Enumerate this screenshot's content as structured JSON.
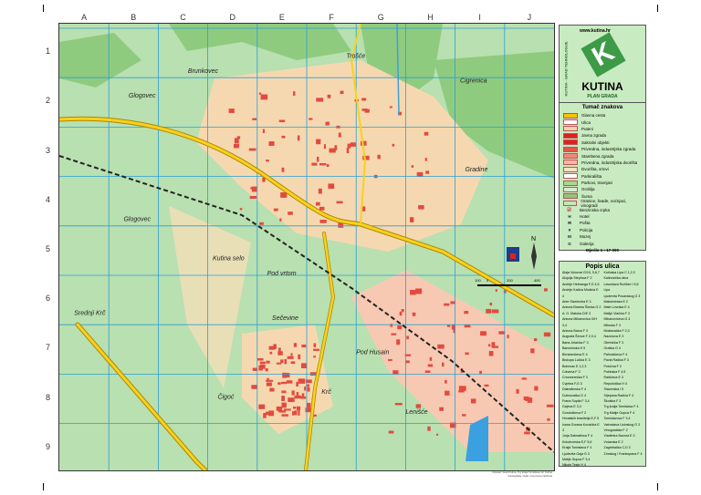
{
  "columns": [
    "A",
    "B",
    "C",
    "D",
    "E",
    "F",
    "G",
    "H",
    "I",
    "J"
  ],
  "rows": [
    "1",
    "2",
    "3",
    "4",
    "5",
    "6",
    "7",
    "8",
    "9"
  ],
  "places": [
    {
      "name": "Brunkovec",
      "c": 2.6,
      "r": 0.9
    },
    {
      "name": "Trošće",
      "c": 5.8,
      "r": 0.6
    },
    {
      "name": "Cigrenica",
      "c": 8.1,
      "r": 1.1
    },
    {
      "name": "Glogovec",
      "c": 1.4,
      "r": 1.4
    },
    {
      "name": "Gradine",
      "c": 8.2,
      "r": 2.9
    },
    {
      "name": "Glogovec",
      "c": 1.3,
      "r": 3.9
    },
    {
      "name": "Kutina selo",
      "c": 3.1,
      "r": 4.7
    },
    {
      "name": "Pod vrtom",
      "c": 4.2,
      "r": 5.0
    },
    {
      "name": "Srednji Krč",
      "c": 0.3,
      "r": 5.8
    },
    {
      "name": "Sečevine",
      "c": 4.3,
      "r": 5.9
    },
    {
      "name": "Pod Husain",
      "c": 6.0,
      "r": 6.6
    },
    {
      "name": "Krč",
      "c": 5.3,
      "r": 7.4
    },
    {
      "name": "Čigoć",
      "c": 3.2,
      "r": 7.5
    },
    {
      "name": "Lenišće",
      "c": 7.0,
      "r": 7.8
    }
  ],
  "logo": {
    "url": "www.kutina.hr",
    "side_text": "KUTINA - GRAD TEHNOLOGIJE",
    "title": "KUTINA",
    "subtitle": "PLAN GRADA"
  },
  "legend": {
    "title": "Tumač znakova",
    "items": [
      {
        "label": "Glavna cesta",
        "color": "#f2c400"
      },
      {
        "label": "Ulica",
        "color": "#ffffff"
      },
      {
        "label": "Puteni",
        "color": "#e9d6b0"
      },
      {
        "label": "Javna zgrada",
        "color": "#e02020"
      },
      {
        "label": "Sakralni objekti",
        "color": "#e02020"
      },
      {
        "label": "Privredna, industrijska zgrada",
        "color": "#e8554a"
      },
      {
        "label": "Stambena zgrada",
        "color": "#f08a78"
      },
      {
        "label": "Privredna, industrijska dvorišta",
        "color": "#f6b7a2"
      },
      {
        "label": "Dvorišta, vrtovi",
        "color": "#fbe0c0"
      },
      {
        "label": "Parkirališta",
        "color": "#ffffff"
      },
      {
        "label": "Parkovi, travnjaci",
        "color": "#a8d88e"
      },
      {
        "label": "Groblja",
        "color": "#d9ead0"
      },
      {
        "label": "Šuma",
        "color": "#8cc77a"
      },
      {
        "label": "Oranice, livade, voćnjaci, vinogradi",
        "color": "#c4e6b8"
      },
      {
        "label": "Benzinska crpka",
        "icon": "⛽"
      },
      {
        "label": "Hotel",
        "icon": "H"
      },
      {
        "label": "Pošta",
        "icon": "✉"
      },
      {
        "label": "Policija",
        "icon": "▼"
      },
      {
        "label": "Muzej",
        "icon": "M"
      },
      {
        "label": "Galerija",
        "icon": "G"
      }
    ],
    "scale": "Mjerilo 1 : 17 000"
  },
  "scalebar": {
    "ticks": [
      "100",
      "0",
      "200",
      "400"
    ],
    "north": "N"
  },
  "index": {
    "title": "Popis ulica",
    "col1": [
      "Alaja Vukovar  G/10, 5,6,7",
      "Alojzija Stepinca  F 2",
      "Andrije Hebranga  F,G 4,5",
      "Andrije Kačića Miošića  E 4",
      "Ante Starčevića  E 3",
      "Antuna Branka Šimića  G 2",
      "A. G. Matoša  D/E 3",
      "Antuna Mihanovića  G/H 3,4",
      "Antuna Barca  F 3",
      "Augusta Šenoe  F 2,3,4",
      "Bana Jelačića  F 3",
      "Banovinska  H 5",
      "Berislavićeva  E 4",
      "Biskupa Lučića  E 3",
      "Bobovac  E 1,2,3",
      "Crkvena  F 3",
      "Crnomerečka  F 3",
      "Cvjetna  F,G 3",
      "Dalmatinska  F 4",
      "Dubrovačka  G 4",
      "Frana Supila  F 3,4",
      "Gajeva  E 3,4",
      "Gundulićeva  F 2",
      "Hrvatskih branitelja  E,F 5",
      "Ivana Gorana Kovačića  E 3",
      "Jurja Dalmatinca  F 4",
      "Kolodvorska  E,F 5,6",
      "Kralja Tomislava  F 4",
      "Ljudevita Gaja  G 3",
      "Matije Gupca  F 3,4",
      "Nikole Tesle  H 4",
      "Petra Preradovića  F 3"
    ],
    "col2": [
      "Kutinska Lipa  C 1,2,3",
      "Kalinovička ulica",
      "Lavoslava Ružičke  I 5,6",
      "Lipa",
      "Ljudevita Posavskog  G 3",
      "Maksimirska  E 2",
      "Mate Lovraka  E 4",
      "Matije Vlačića  F 3",
      "Mihanovićeva  G 3",
      "Mlinska  F 3",
      "Moslavačka  F 2,3",
      "Nazorova  E 3",
      "Obrtnička  F 3",
      "Oraška  G 4",
      "Palmotićeva  F 4",
      "Pavla Radića  F 3",
      "Potočna  F 2",
      "Pušinska  F 4,5",
      "Radićeva  E 3",
      "Repušnička  H 4",
      "Slavonska  I 5",
      "Stjepana Radića  F 4",
      "Školska  F 3",
      "Trg kralja Tomislava  F 4",
      "Trg Matije Gupca  F 4",
      "Tomislavova  F 3,4",
      "Vatroslava Lisinskog  G 3",
      "Vinogradska  F 2",
      "Vladimira Nazora  E 3",
      "Voćarska  E 2",
      "Zagrebačka  C,D 3",
      "Zrinskog i Frankopana  F 4"
    ]
  },
  "footer": [
    "Izdavač: Grad Kutina, Trg kralja Tomislava 12, Kutina",
    "Kartografija i tisak: sva prava pridržana"
  ]
}
